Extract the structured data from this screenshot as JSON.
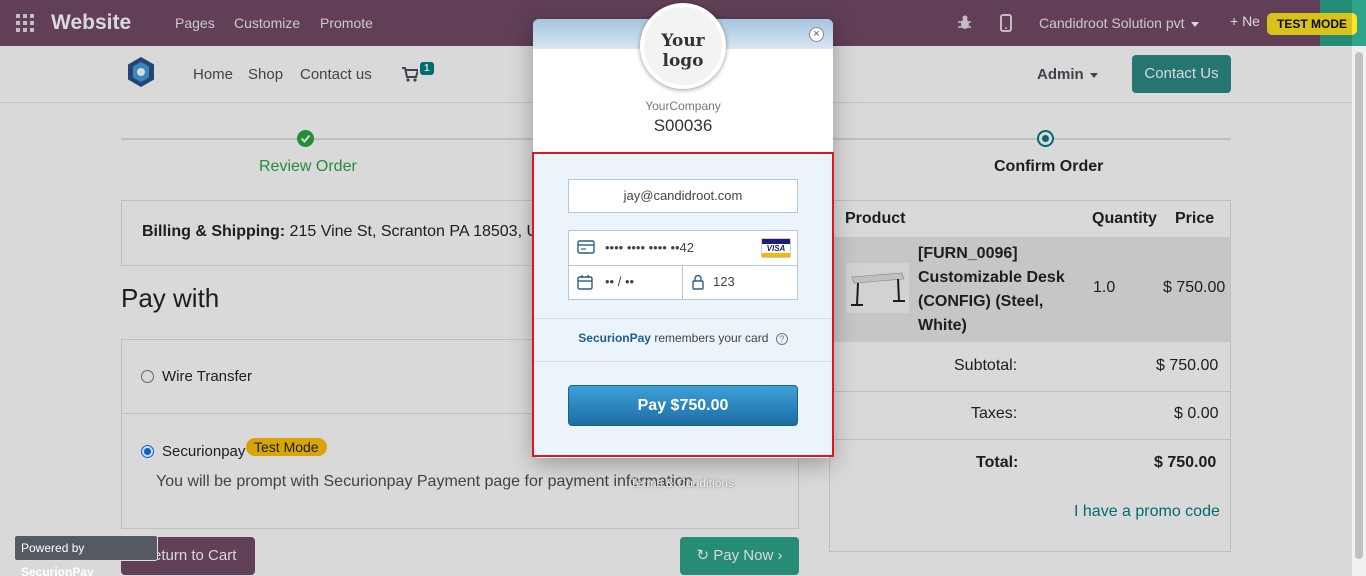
{
  "topbar": {
    "brand": "Website",
    "menu": [
      "Pages",
      "Customize",
      "Promote"
    ],
    "company": "Candidroot Solution pvt",
    "new_label": "+ Ne",
    "test_mode": "TEST MODE"
  },
  "nav": {
    "links": [
      "Home",
      "Shop",
      "Contact us"
    ],
    "cart_count": "1",
    "admin": "Admin",
    "contact_button": "Contact Us"
  },
  "steps": {
    "review": "Review Order",
    "confirm": "Confirm Order"
  },
  "billing": {
    "label": "Billing & Shipping:",
    "address": "215 Vine St, Scranton PA 18503, Uni"
  },
  "payment": {
    "heading": "Pay with",
    "options": [
      {
        "label": "Wire Transfer",
        "selected": false
      },
      {
        "label": "Securionpay",
        "selected": true,
        "badge": "Test Mode"
      }
    ],
    "description": "You will be prompt with Securionpay Payment page for payment information.",
    "return_button": "Return to Cart",
    "pay_now_button": "Pay Now"
  },
  "order": {
    "headers": {
      "product": "Product",
      "quantity": "Quantity",
      "price": "Price"
    },
    "item": {
      "name": "[FURN_0096] Customizable Desk (CONFIG) (Steel, White)",
      "quantity": "1.0",
      "price": "$ 750.00"
    },
    "subtotal_label": "Subtotal:",
    "subtotal": "$ 750.00",
    "taxes_label": "Taxes:",
    "taxes": "$ 0.00",
    "total_label": "Total:",
    "total": "$ 750.00",
    "promo": "I have a promo code"
  },
  "modal": {
    "logo_text": "Your logo",
    "company": "YourCompany",
    "order_ref": "S00036",
    "email": "jay@candidroot.com",
    "card_number": "•••• •••• •••• ••42",
    "card_brand": "VISA",
    "expiry": "•• / ••",
    "cvc": "123",
    "remember_brand": "SecurionPay",
    "remember_text": "remembers your card",
    "pay_button": "Pay $750.00",
    "terms": "Terms & Conditions",
    "powered_by": "Powered by",
    "powered_brand": "SecurionPay",
    "close": "×"
  },
  "colors": {
    "topbar": "#714b67",
    "accent": "#2c8a87",
    "success": "#28a745",
    "modal_border": "#d7191c",
    "pay_button": "#1c6ea4"
  }
}
